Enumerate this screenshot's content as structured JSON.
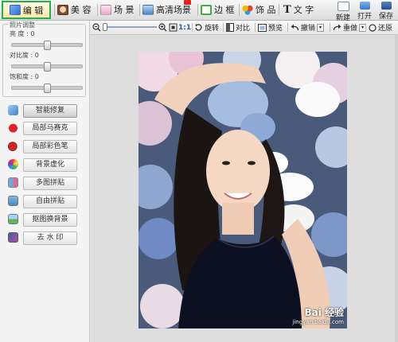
{
  "tabs": [
    {
      "label": "编 辑",
      "icon": "edit-icon",
      "active": true
    },
    {
      "label": "美 容",
      "icon": "beauty-face-icon",
      "active": false
    },
    {
      "label": "场 景",
      "icon": "scene-icon",
      "active": false
    },
    {
      "label": "高清场景",
      "icon": "hd-scene-icon",
      "active": false,
      "badge": "hd-badge"
    },
    {
      "label": "边 框",
      "icon": "frame-icon",
      "active": false
    },
    {
      "label": "饰 品",
      "icon": "accessory-icon",
      "active": false
    },
    {
      "label": "文 字",
      "icon": "text-icon",
      "active": false
    }
  ],
  "file_buttons": {
    "new": "新建",
    "open": "打开",
    "save": "保存"
  },
  "adjust": {
    "title": "照片调整",
    "brightness": {
      "label": "亮   度 : 0",
      "value": 0
    },
    "contrast": {
      "label": "对比度 : 0",
      "value": 0
    },
    "saturation": {
      "label": "饱和度 : 0",
      "value": 0
    }
  },
  "tools": [
    {
      "label": "智能修复",
      "icon": "magic-repair-icon"
    },
    {
      "label": "局部马赛克",
      "icon": "heart-mosaic-icon"
    },
    {
      "label": "局部彩色笔",
      "icon": "color-pen-icon"
    },
    {
      "label": "背景虚化",
      "icon": "blur-bg-icon"
    },
    {
      "label": "多图拼贴",
      "icon": "multi-collage-icon"
    },
    {
      "label": "自由拼贴",
      "icon": "free-collage-icon"
    },
    {
      "label": "抠图换背景",
      "icon": "cutout-icon"
    },
    {
      "label": "去 水 印",
      "icon": "remove-watermark-icon"
    }
  ],
  "toolbar": {
    "zoom_ratio": "1:1",
    "rotate": "旋转",
    "contrast": "对比",
    "preview": "预览",
    "undo": "撤销",
    "redo": "重做",
    "restore": "还原"
  },
  "watermark": {
    "brand": "Bai 经验",
    "url": "jingyan.baidu.com"
  },
  "colors": {
    "active_tab_border": "#22b04a",
    "accent": "#3d7bd6"
  }
}
